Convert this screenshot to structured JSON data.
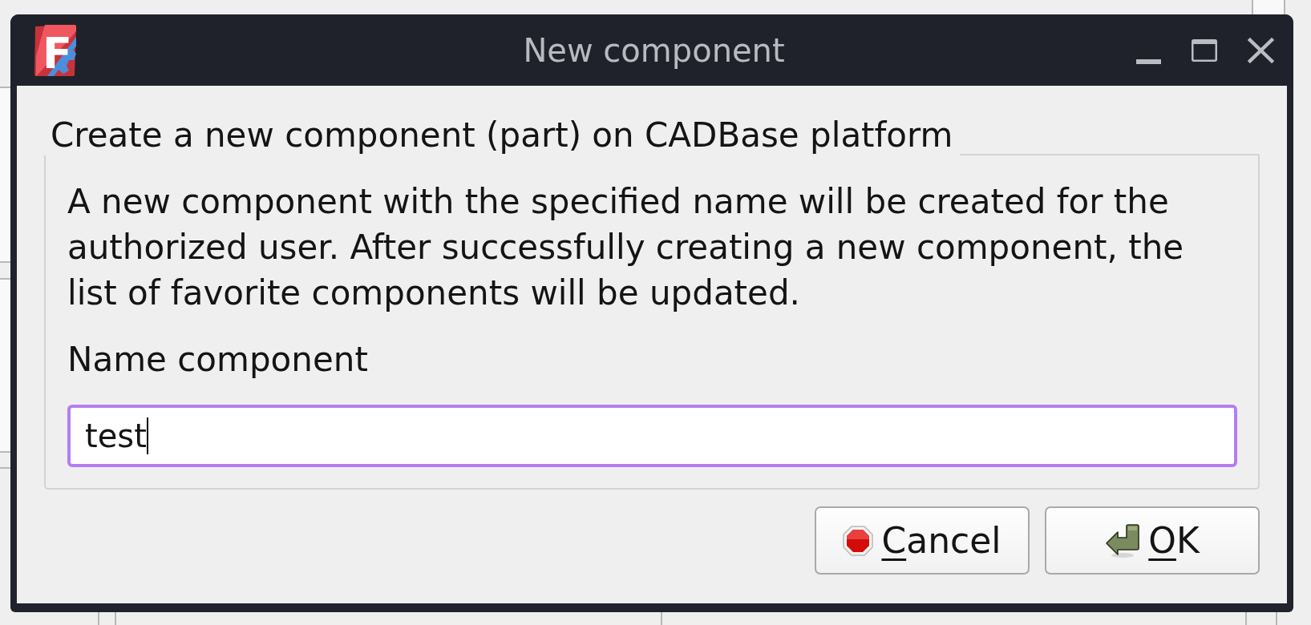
{
  "window": {
    "title": "New component",
    "logo_letter": "F"
  },
  "group": {
    "title": "Create a new component (part) on CADBase platform",
    "description": "A new component with the specified name will be created for the authorized user. After successfully creating a new component, the list of favorite components will be updated.",
    "field_label": "Name component",
    "field": {
      "value": "test",
      "focused": true
    }
  },
  "buttons": [
    {
      "kind": "cancel",
      "label": "Cancel",
      "mnemonic_underlined": true
    },
    {
      "kind": "ok",
      "label": "OK",
      "mnemonic_underlined": true
    }
  ]
}
